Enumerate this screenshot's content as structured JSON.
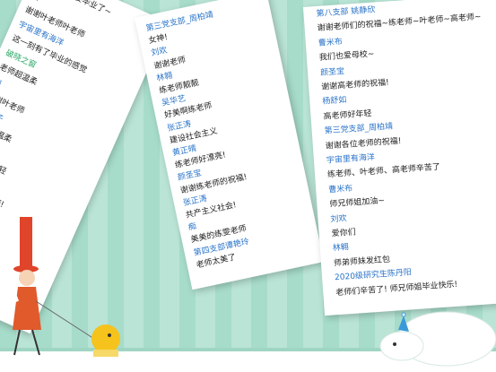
{
  "card_left": {
    "lines": [
      {
        "t": "有消息了，要毕业了~",
        "k": "txt"
      },
      {
        "t": "权",
        "k": "nm"
      },
      {
        "t": "谢谢叶老师叶老师",
        "k": "txt"
      },
      {
        "t": "宇宙里有海洋",
        "k": "nm"
      },
      {
        "t": "这一刻有了毕业的感觉",
        "k": "txt"
      },
      {
        "t": "破晓之窗",
        "k": "gn"
      },
      {
        "t": "老师超温柔",
        "k": "txt"
      },
      {
        "t": "痴",
        "k": "nm"
      },
      {
        "t": "谢谢叶老师",
        "k": "txt"
      },
      {
        "t": "小珊子",
        "k": "nm"
      },
      {
        "t": "叶老师温柔",
        "k": "txt"
      },
      {
        "t": "吴华艺",
        "k": "nm"
      },
      {
        "t": "叶老师好年轻",
        "k": "txt"
      },
      {
        "t": "林翱",
        "k": "nm"
      },
      {
        "t": "谨遵叶老师教诲!",
        "k": "txt"
      },
      {
        "t": "颜圣宝",
        "k": "nm"
      },
      {
        "t": "谢谢叶老师的祝福!",
        "k": "txt"
      },
      {
        "t": "谢鸭宁",
        "k": "nm"
      },
      {
        "t": "想回学校了",
        "k": "txt"
      }
    ]
  },
  "card_middle": {
    "lines": [
      {
        "t": "第三党支部_周柏靖",
        "k": "nm"
      },
      {
        "t": "女神!",
        "k": "txt"
      },
      {
        "t": "刘欢",
        "k": "nm"
      },
      {
        "t": "谢谢老师",
        "k": "txt"
      },
      {
        "t": "林翱",
        "k": "nm"
      },
      {
        "t": "练老师靓靓",
        "k": "txt"
      },
      {
        "t": "吴华艺",
        "k": "nm"
      },
      {
        "t": "好美啊练老师",
        "k": "txt"
      },
      {
        "t": "张正涛",
        "k": "nm"
      },
      {
        "t": "建设社会主义",
        "k": "txt"
      },
      {
        "t": "黄正晴",
        "k": "nm"
      },
      {
        "t": "练老师好漂亮!",
        "k": "txt"
      },
      {
        "t": "颜圣宝",
        "k": "nm"
      },
      {
        "t": "谢谢练老师的祝福!",
        "k": "txt"
      },
      {
        "t": "张正涛",
        "k": "nm"
      },
      {
        "t": "共产主义社会!",
        "k": "txt"
      },
      {
        "t": "痴",
        "k": "nm"
      },
      {
        "t": "美美的练雯老师",
        "k": "txt"
      },
      {
        "t": "第四支部谭艳玲",
        "k": "nm"
      },
      {
        "t": "老师太美了",
        "k": "txt"
      }
    ]
  },
  "card_right": {
    "lines": [
      {
        "t": "第八支部 姚静欣",
        "k": "nm"
      },
      {
        "t": "谢谢老师们的祝福~练老师~叶老师~高老师~",
        "k": "txt"
      },
      {
        "t": "曹米布",
        "k": "nm"
      },
      {
        "t": "我们也爱母校~",
        "k": "txt"
      },
      {
        "t": "颜圣宝",
        "k": "nm"
      },
      {
        "t": "谢谢高老师的祝福!",
        "k": "txt"
      },
      {
        "t": "杨舒如",
        "k": "nm"
      },
      {
        "t": "高老师好年轻",
        "k": "txt"
      },
      {
        "t": "第三党支部_周柏靖",
        "k": "nm"
      },
      {
        "t": "谢谢各位老师的祝福!",
        "k": "txt"
      },
      {
        "t": "宇宙里有海洋",
        "k": "nm"
      },
      {
        "t": "练老师、叶老师、高老师辛苦了",
        "k": "txt"
      },
      {
        "t": "曹米布",
        "k": "nm"
      },
      {
        "t": "师兄师姐加油~",
        "k": "txt"
      },
      {
        "t": "刘欢",
        "k": "nm"
      },
      {
        "t": "爱你们",
        "k": "txt"
      },
      {
        "t": "林翱",
        "k": "nm"
      },
      {
        "t": "师弟师妹发红包",
        "k": "txt"
      },
      {
        "t": "2020级研究生陈丹阳",
        "k": "nm"
      },
      {
        "t": "老师们辛苦了! 师兄师姐毕业快乐!",
        "k": "txt"
      }
    ]
  },
  "colors": {
    "background": "#b9e4d6",
    "name_blue": "#2a74c9",
    "name_green": "#2fa868"
  }
}
